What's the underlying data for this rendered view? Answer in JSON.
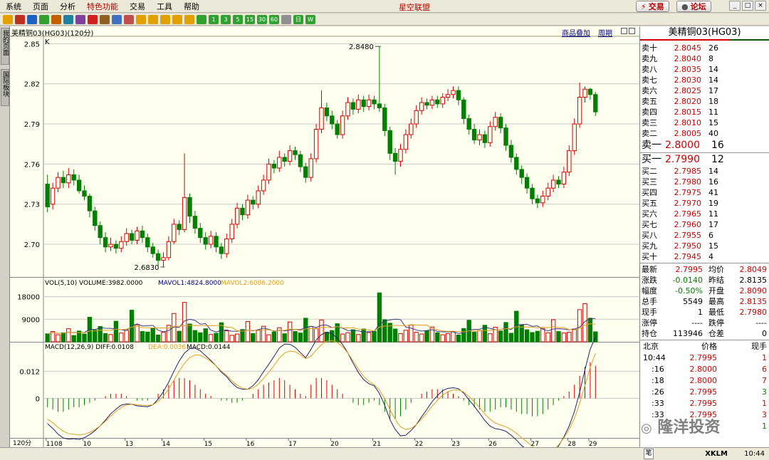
{
  "app": {
    "title": "星空联盟"
  },
  "menu": [
    "系统",
    "页面",
    "分析",
    "特色功能",
    "交易",
    "工具",
    "帮助"
  ],
  "top_buttons": {
    "trade": "交易",
    "forum": "论坛"
  },
  "toolbar_icons": [
    "back-icon",
    "home-icon",
    "quote-icon",
    "refresh-icon",
    "zoom-icon",
    "chart-icon",
    "pen-icon",
    "alert-icon",
    "filter-icon",
    "table-icon",
    "compare-icon",
    "f1",
    "f2",
    "f3",
    "f4",
    "f5",
    "f6",
    "f7",
    "f8",
    "f9",
    "f10",
    "f11",
    "f12",
    "f13",
    "f14",
    "f15"
  ],
  "toolbar_labels": [
    "1",
    "3",
    "5",
    "15",
    "30",
    "60",
    "",
    "日",
    "W"
  ],
  "left_tabs": [
    "我的页面",
    "国际板块"
  ],
  "chart": {
    "header_title": "美精铜03(HG03)(120分)",
    "link_overlay": "商品叠加",
    "link_period": "周期",
    "price_axis": [
      "2.85",
      "2.82",
      "2.79",
      "2.76",
      "2.73",
      "2.70"
    ],
    "k_label": "K",
    "high_label": "2.8480",
    "low_label": "2.6830",
    "vol_header": "VOL(5,10) VOLUME:3982.0000",
    "vol_ma1": "MAVOL1:4824.8000",
    "vol_ma2": "MAVOL2:6086.2000",
    "vol_axis": [
      "18000",
      "9000"
    ],
    "macd_header": "MACD(12,26,9) DIFF:0.0108",
    "macd_dea": "DEA:0.0036",
    "macd_macd": "MACD:0.0144",
    "macd_axis": [
      "0.012",
      "0"
    ],
    "period_label": "120分",
    "x_labels": [
      "1108",
      "10",
      "13",
      "14",
      "15",
      "16",
      "17",
      "20",
      "21",
      "22",
      "23",
      "26",
      "27",
      "28",
      "29"
    ]
  },
  "chart_data": {
    "type": "candlestick",
    "title": "美精铜03(HG03)(120分)",
    "ylim": [
      2.675,
      2.855
    ],
    "candles": [
      [
        2.745,
        2.728,
        2.752,
        2.724
      ],
      [
        2.73,
        2.742,
        2.746,
        2.726
      ],
      [
        2.742,
        2.75,
        2.754,
        2.739
      ],
      [
        2.75,
        2.746,
        2.755,
        2.742
      ],
      [
        2.746,
        2.752,
        2.757,
        2.742
      ],
      [
        2.752,
        2.748,
        2.756,
        2.744
      ],
      [
        2.748,
        2.74,
        2.752,
        2.738
      ],
      [
        2.74,
        2.736,
        2.744,
        2.733
      ],
      [
        2.736,
        2.725,
        2.738,
        2.72
      ],
      [
        2.725,
        2.714,
        2.728,
        2.71
      ],
      [
        2.714,
        2.705,
        2.717,
        2.7
      ],
      [
        2.705,
        2.698,
        2.709,
        2.694
      ],
      [
        2.698,
        2.7,
        2.705,
        2.695
      ],
      [
        2.7,
        2.697,
        2.703,
        2.693
      ],
      [
        2.697,
        2.702,
        2.706,
        2.694
      ],
      [
        2.702,
        2.708,
        2.712,
        2.699
      ],
      [
        2.708,
        2.703,
        2.711,
        2.7
      ],
      [
        2.703,
        2.71,
        2.713,
        2.7
      ],
      [
        2.71,
        2.705,
        2.714,
        2.701
      ],
      [
        2.705,
        2.698,
        2.708,
        2.694
      ],
      [
        2.698,
        2.693,
        2.701,
        2.69
      ],
      [
        2.693,
        2.688,
        2.696,
        2.684
      ],
      [
        2.688,
        2.69,
        2.694,
        2.683
      ],
      [
        2.69,
        2.702,
        2.706,
        2.688
      ],
      [
        2.702,
        2.715,
        2.719,
        2.7
      ],
      [
        2.715,
        2.711,
        2.718,
        2.707
      ],
      [
        2.711,
        2.735,
        2.768,
        2.709
      ],
      [
        2.735,
        2.721,
        2.738,
        2.716
      ],
      [
        2.721,
        2.712,
        2.725,
        2.708
      ],
      [
        2.712,
        2.705,
        2.716,
        2.701
      ],
      [
        2.705,
        2.7,
        2.709,
        2.696
      ],
      [
        2.7,
        2.706,
        2.71,
        2.697
      ],
      [
        2.706,
        2.698,
        2.709,
        2.694
      ],
      [
        2.698,
        2.693,
        2.701,
        2.689
      ],
      [
        2.693,
        2.704,
        2.708,
        2.69
      ],
      [
        2.704,
        2.715,
        2.719,
        2.701
      ],
      [
        2.715,
        2.727,
        2.731,
        2.712
      ],
      [
        2.727,
        2.722,
        2.73,
        2.718
      ],
      [
        2.722,
        2.733,
        2.737,
        2.719
      ],
      [
        2.733,
        2.73,
        2.736,
        2.726
      ],
      [
        2.73,
        2.74,
        2.744,
        2.727
      ],
      [
        2.74,
        2.748,
        2.752,
        2.737
      ],
      [
        2.748,
        2.76,
        2.764,
        2.745
      ],
      [
        2.76,
        2.757,
        2.763,
        2.753
      ],
      [
        2.757,
        2.765,
        2.77,
        2.754
      ],
      [
        2.765,
        2.762,
        2.768,
        2.758
      ],
      [
        2.762,
        2.77,
        2.774,
        2.759
      ],
      [
        2.77,
        2.767,
        2.773,
        2.763
      ],
      [
        2.767,
        2.758,
        2.77,
        2.754
      ],
      [
        2.758,
        2.75,
        2.761,
        2.746
      ],
      [
        2.75,
        2.764,
        2.768,
        2.747
      ],
      [
        2.764,
        2.786,
        2.79,
        2.761
      ],
      [
        2.786,
        2.802,
        2.815,
        2.783
      ],
      [
        2.802,
        2.796,
        2.806,
        2.792
      ],
      [
        2.796,
        2.79,
        2.8,
        2.786
      ],
      [
        2.79,
        2.782,
        2.793,
        2.779
      ],
      [
        2.782,
        2.796,
        2.8,
        2.779
      ],
      [
        2.796,
        2.806,
        2.81,
        2.793
      ],
      [
        2.806,
        2.801,
        2.809,
        2.797
      ],
      [
        2.801,
        2.808,
        2.812,
        2.798
      ],
      [
        2.808,
        2.803,
        2.811,
        2.799
      ],
      [
        2.803,
        2.808,
        2.812,
        2.8
      ],
      [
        2.808,
        2.805,
        2.811,
        2.801
      ],
      [
        2.805,
        2.802,
        2.848,
        2.799
      ],
      [
        2.802,
        2.785,
        2.805,
        2.781
      ],
      [
        2.785,
        2.768,
        2.788,
        2.763
      ],
      [
        2.768,
        2.762,
        2.772,
        2.752
      ],
      [
        2.762,
        2.771,
        2.775,
        2.758
      ],
      [
        2.771,
        2.782,
        2.786,
        2.768
      ],
      [
        2.782,
        2.79,
        2.794,
        2.779
      ],
      [
        2.79,
        2.8,
        2.804,
        2.787
      ],
      [
        2.8,
        2.806,
        2.81,
        2.797
      ],
      [
        2.806,
        2.804,
        2.809,
        2.801
      ],
      [
        2.804,
        2.808,
        2.811,
        2.801
      ],
      [
        2.808,
        2.805,
        2.811,
        2.802
      ],
      [
        2.805,
        2.81,
        2.813,
        2.802
      ],
      [
        2.81,
        2.812,
        2.816,
        2.807
      ],
      [
        2.812,
        2.815,
        2.818,
        2.809
      ],
      [
        2.815,
        2.808,
        2.818,
        2.804
      ],
      [
        2.808,
        2.794,
        2.81,
        2.79
      ],
      [
        2.794,
        2.786,
        2.797,
        2.782
      ],
      [
        2.786,
        2.778,
        2.79,
        2.775
      ],
      [
        2.778,
        2.782,
        2.786,
        2.774
      ],
      [
        2.782,
        2.776,
        2.785,
        2.772
      ],
      [
        2.776,
        2.788,
        2.792,
        2.773
      ],
      [
        2.788,
        2.795,
        2.799,
        2.785
      ],
      [
        2.795,
        2.787,
        2.798,
        2.783
      ],
      [
        2.787,
        2.774,
        2.79,
        2.77
      ],
      [
        2.774,
        2.765,
        2.778,
        2.761
      ],
      [
        2.765,
        2.756,
        2.768,
        2.752
      ],
      [
        2.756,
        2.75,
        2.759,
        2.745
      ],
      [
        2.75,
        2.742,
        2.753,
        2.738
      ],
      [
        2.742,
        2.734,
        2.745,
        2.73
      ],
      [
        2.734,
        2.731,
        2.737,
        2.727
      ],
      [
        2.731,
        2.736,
        2.74,
        2.728
      ],
      [
        2.736,
        2.742,
        2.746,
        2.733
      ],
      [
        2.742,
        2.748,
        2.752,
        2.739
      ],
      [
        2.748,
        2.745,
        2.751,
        2.742
      ],
      [
        2.745,
        2.754,
        2.758,
        2.742
      ],
      [
        2.754,
        2.77,
        2.774,
        2.751
      ],
      [
        2.77,
        2.79,
        2.794,
        2.767
      ],
      [
        2.79,
        2.81,
        2.821,
        2.787
      ],
      [
        2.81,
        2.816,
        2.818,
        2.806
      ],
      [
        2.816,
        2.812,
        2.817,
        2.808
      ],
      [
        2.812,
        2.799,
        2.814,
        2.796
      ]
    ],
    "volume": [
      3200,
      4100,
      2800,
      3600,
      5200,
      2500,
      4300,
      3100,
      9800,
      4700,
      6100,
      3300,
      2900,
      8200,
      3500,
      4600,
      12600,
      6800,
      4100,
      3900,
      5400,
      2700,
      3800,
      6600,
      11300,
      4200,
      15700,
      7100,
      4500,
      3600,
      5200,
      2900,
      3400,
      7600,
      4400,
      2600,
      3100,
      4900,
      8100,
      3300,
      4700,
      6200,
      2800,
      3900,
      5600,
      3200,
      7900,
      4100,
      3500,
      9400,
      6100,
      5300,
      8700,
      3800,
      4500,
      7200,
      3100,
      3600,
      4800,
      2900,
      5100,
      3700,
      4200,
      19500,
      8800,
      7400,
      5100,
      3300,
      4600,
      6700,
      3800,
      3100,
      4400,
      5900,
      3600,
      2800,
      3300,
      4100,
      2700,
      5300,
      8600,
      3900,
      4500,
      6600,
      3200,
      5800,
      4300,
      7700,
      3400,
      12200,
      6800,
      4800,
      3700,
      4200,
      5300,
      3600,
      8800,
      4100,
      3500,
      3800,
      5100,
      12800,
      15200,
      9400,
      3982
    ],
    "macd_hist": [
      -0.004,
      -0.005,
      -0.006,
      -0.006,
      -0.005,
      -0.004,
      -0.004,
      -0.003,
      -0.002,
      -0.001,
      0.0,
      0.001,
      0.002,
      0.002,
      0.002,
      0.001,
      0.0,
      -0.001,
      -0.001,
      -0.001,
      0.0,
      0.002,
      0.004,
      0.006,
      0.008,
      0.009,
      0.009,
      0.008,
      0.006,
      0.004,
      0.002,
      0.001,
      0.0,
      -0.001,
      -0.001,
      -0.002,
      -0.002,
      -0.001,
      0.0,
      0.002,
      0.004,
      0.006,
      0.007,
      0.008,
      0.009,
      0.008,
      0.006,
      0.004,
      0.002,
      0.001,
      0.006,
      0.009,
      0.009,
      0.008,
      0.006,
      0.004,
      0.002,
      0.0,
      -0.002,
      -0.003,
      -0.003,
      -0.002,
      -0.001,
      -0.003,
      -0.006,
      -0.009,
      -0.009,
      -0.008,
      -0.005,
      -0.002,
      0.0,
      0.002,
      0.003,
      0.004,
      0.004,
      0.004,
      0.003,
      0.002,
      0.001,
      -0.001,
      -0.003,
      -0.004,
      -0.005,
      -0.006,
      -0.006,
      -0.005,
      -0.004,
      -0.004,
      -0.005,
      -0.006,
      -0.007,
      -0.007,
      -0.008,
      -0.008,
      -0.007,
      -0.005,
      -0.003,
      -0.001,
      0.001,
      0.003,
      0.006,
      0.01,
      0.014,
      0.016,
      0.0144
    ],
    "macd_ylim": [
      -0.016,
      0.02
    ]
  },
  "orderbook": {
    "title": "美精铜03(HG03)",
    "asks": [
      {
        "label": "卖十",
        "price": "2.8045",
        "vol": "26"
      },
      {
        "label": "卖九",
        "price": "2.8040",
        "vol": "8"
      },
      {
        "label": "卖八",
        "price": "2.8035",
        "vol": "14"
      },
      {
        "label": "卖七",
        "price": "2.8030",
        "vol": "14"
      },
      {
        "label": "卖六",
        "price": "2.8025",
        "vol": "17"
      },
      {
        "label": "卖五",
        "price": "2.8020",
        "vol": "18"
      },
      {
        "label": "卖四",
        "price": "2.8015",
        "vol": "11"
      },
      {
        "label": "卖三",
        "price": "2.8010",
        "vol": "15"
      },
      {
        "label": "卖二",
        "price": "2.8005",
        "vol": "40"
      },
      {
        "label": "卖一",
        "price": "2.8000",
        "vol": "16"
      }
    ],
    "bids": [
      {
        "label": "买一",
        "price": "2.7990",
        "vol": "12"
      },
      {
        "label": "买二",
        "price": "2.7985",
        "vol": "14"
      },
      {
        "label": "买三",
        "price": "2.7980",
        "vol": "16"
      },
      {
        "label": "买四",
        "price": "2.7975",
        "vol": "41"
      },
      {
        "label": "买五",
        "price": "2.7970",
        "vol": "19"
      },
      {
        "label": "买六",
        "price": "2.7965",
        "vol": "11"
      },
      {
        "label": "买七",
        "price": "2.7960",
        "vol": "17"
      },
      {
        "label": "买八",
        "price": "2.7955",
        "vol": "6"
      },
      {
        "label": "买九",
        "price": "2.7950",
        "vol": "15"
      },
      {
        "label": "买十",
        "price": "2.7945",
        "vol": "4"
      }
    ],
    "stats": [
      {
        "k1": "最新",
        "v1": "2.7995",
        "c1": "red",
        "k2": "均价",
        "v2": "2.8049",
        "c2": "red"
      },
      {
        "k1": "涨跌",
        "v1": "-0.0140",
        "c1": "grn",
        "k2": "昨结",
        "v2": "2.8135",
        "c2": ""
      },
      {
        "k1": "幅度",
        "v1": "-0.50%",
        "c1": "grn",
        "k2": "开盘",
        "v2": "2.8090",
        "c2": "red"
      },
      {
        "k1": "总手",
        "v1": "5549",
        "c1": "",
        "k2": "最高",
        "v2": "2.8135",
        "c2": "red"
      },
      {
        "k1": "现手",
        "v1": "1",
        "c1": "",
        "k2": "最低",
        "v2": "2.7980",
        "c2": "red"
      },
      {
        "k1": "涨停",
        "v1": "----",
        "c1": "",
        "k2": "跌停",
        "v2": "----",
        "c2": ""
      },
      {
        "k1": "持仓",
        "v1": "113946",
        "c1": "",
        "k2": "仓差",
        "v2": "0",
        "c2": ""
      }
    ],
    "ticks_header": {
      "city": "北京",
      "price": "价格",
      "vol": "现手"
    },
    "ticks": [
      {
        "time": "10:44",
        "price": "2.7995",
        "vol": "1",
        "vc": "red"
      },
      {
        "time": ":16",
        "price": "2.8000",
        "vol": "6",
        "vc": "red"
      },
      {
        "time": ":18",
        "price": "2.8000",
        "vol": "7",
        "vc": "red"
      },
      {
        "time": ":26",
        "price": "2.7995",
        "vol": "3",
        "vc": "grn"
      },
      {
        "time": ":33",
        "price": "2.7995",
        "vol": "1",
        "vc": "red"
      },
      {
        "time": ":33",
        "price": "2.7995",
        "vol": "3",
        "vc": "red"
      },
      {
        "time": "",
        "price": "",
        "vol": "1",
        "vc": "grn"
      }
    ]
  },
  "watermark": "隆洋投资",
  "status": {
    "brand": "XKLM",
    "time": "10:44",
    "tab": "笔"
  },
  "colors": {
    "up": "#d40000",
    "down": "#008000",
    "grid": "#c8c8c8",
    "ma1": "#3a3a8a",
    "ma2": "#e0a020"
  }
}
